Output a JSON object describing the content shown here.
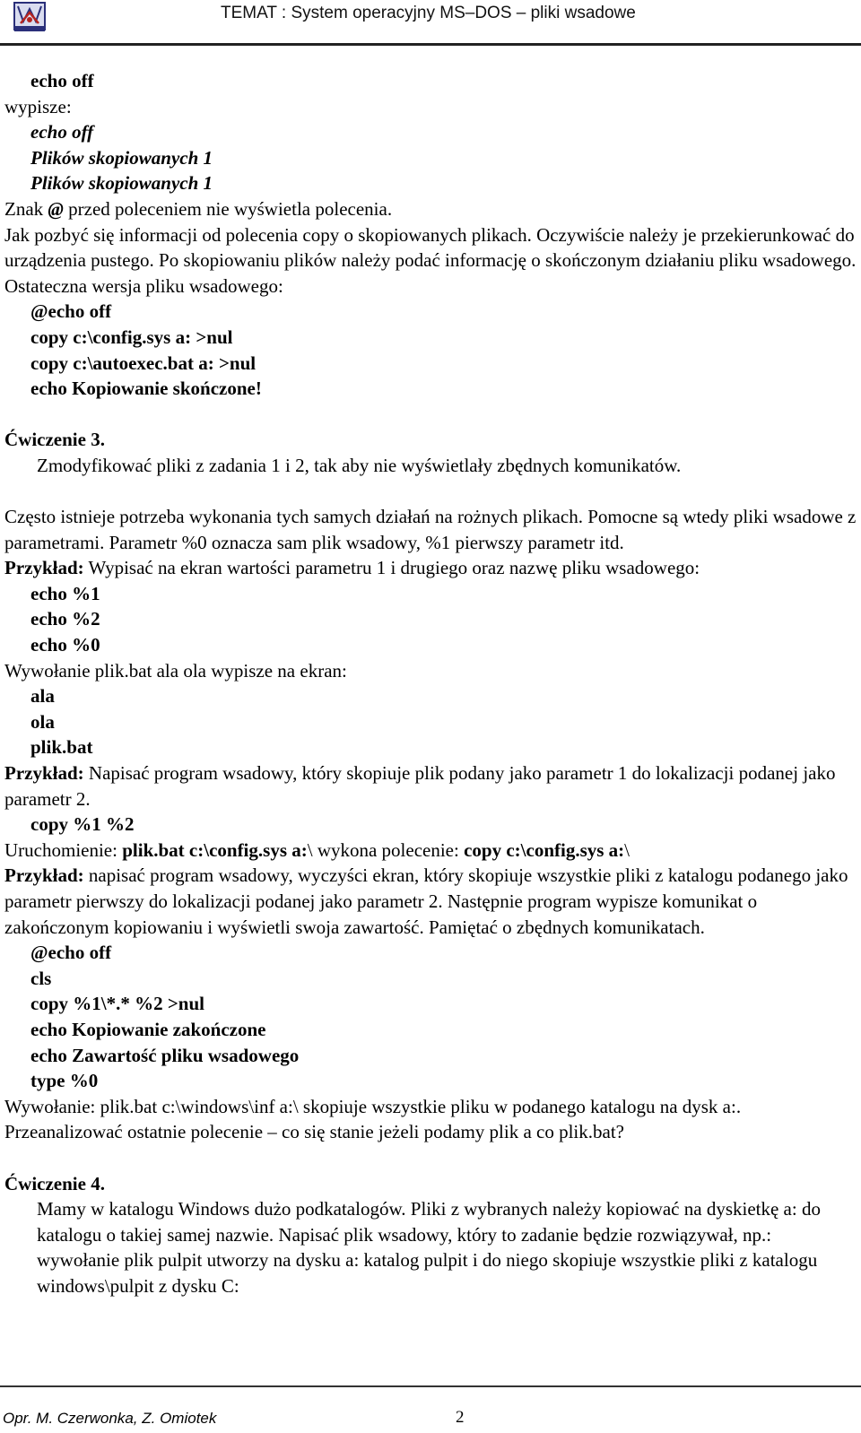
{
  "header": {
    "logo_icon": "school-crest-icon",
    "title": "TEMAT : System operacyjny MS–DOS – pliki wsadowe"
  },
  "content": {
    "block1_cmd": "echo off",
    "wypisze_label": "wypisze:",
    "output_lines": [
      "echo off",
      "Plików skopiowanych 1",
      "Plików skopiowanych 1"
    ],
    "znak_pre": "Znak ",
    "znak_at": "@",
    "znak_post": " przed poleceniem nie wyświetla polecenia.",
    "para_redirect": "Jak pozbyć się informacji od polecenia copy o skopiowanych plikach. Oczywiście należy je przekierunkować do urządzenia pustego. Po skopiowaniu plików należy podać informację o skończonym działaniu pliku wsadowego. Ostateczna wersja pliku wsadowego:",
    "final_version_lines": [
      "@echo off",
      "copy c:\\config.sys a: >nul",
      "copy c:\\autoexec.bat a: >nul",
      "echo Kopiowanie skończone!"
    ],
    "exercise3_title": "Ćwiczenie 3.",
    "exercise3_text": "Zmodyfikować pliki z zadania 1 i 2, tak aby nie wyświetlały zbędnych komunikatów.",
    "params_para": "Często istnieje potrzeba wykonania tych samych działań na rożnych plikach. Pomocne są wtedy pliki wsadowe z parametrami. Parametr %0 oznacza sam plik wsadowy, %1 pierwszy parametr itd.",
    "example_label": "Przykład:",
    "example1_text": " Wypisać na ekran wartości parametru 1 i drugiego oraz nazwę pliku wsadowego:",
    "example1_lines": [
      "echo %1",
      "echo %2",
      "echo %0"
    ],
    "example1_call": "Wywołanie plik.bat ala ola wypisze na ekran:",
    "example1_output": [
      "ala",
      "ola",
      "plik.bat"
    ],
    "example2_text": " Napisać program wsadowy, który skopiuje plik podany jako parametr 1 do lokalizacji podanej jako parametr 2.",
    "example2_lines": [
      "copy %1 %2"
    ],
    "run_label": "Uruchomienie: ",
    "run_cmd": "plik.bat c:\\config.sys a:",
    "run_mid": "\\ wykona polecenie: ",
    "run_result": "copy c:\\config.sys a:",
    "run_tail": "\\",
    "example3_text": " napisać program wsadowy, wyczyści ekran, który skopiuje wszystkie pliki z katalogu podanego jako parametr pierwszy do lokalizacji podanej jako parametr 2. Następnie program wypisze komunikat o zakończonym kopiowaniu i wyświetli swoja zawartość. Pamiętać o zbędnych komunikatach.",
    "example3_lines": [
      "@echo off",
      "cls",
      "copy %1\\*.* %2 >nul",
      "echo Kopiowanie zakończone",
      "echo Zawartość pliku wsadowego",
      "type %0"
    ],
    "example3_call": "Wywołanie: plik.bat c:\\windows\\inf a:\\ skopiuje wszystkie pliku w podanego katalogu na dysk a:. Przeanalizować ostatnie polecenie – co się stanie jeżeli podamy plik a co plik.bat?",
    "exercise4_title": "Ćwiczenie 4.",
    "exercise4_text": "Mamy w katalogu Windows dużo podkatalogów. Pliki z wybranych należy kopiować na dyskietkę a: do katalogu o takiej samej nazwie. Napisać plik wsadowy, który to zadanie będzie rozwiązywał, np.: wywołanie plik pulpit utworzy na dysku a: katalog pulpit i do niego skopiuje wszystkie pliki z katalogu windows\\pulpit z dysku C:"
  },
  "footer": {
    "authors": "Opr. M. Czerwonka, Z. Omiotek",
    "page_number": "2"
  }
}
